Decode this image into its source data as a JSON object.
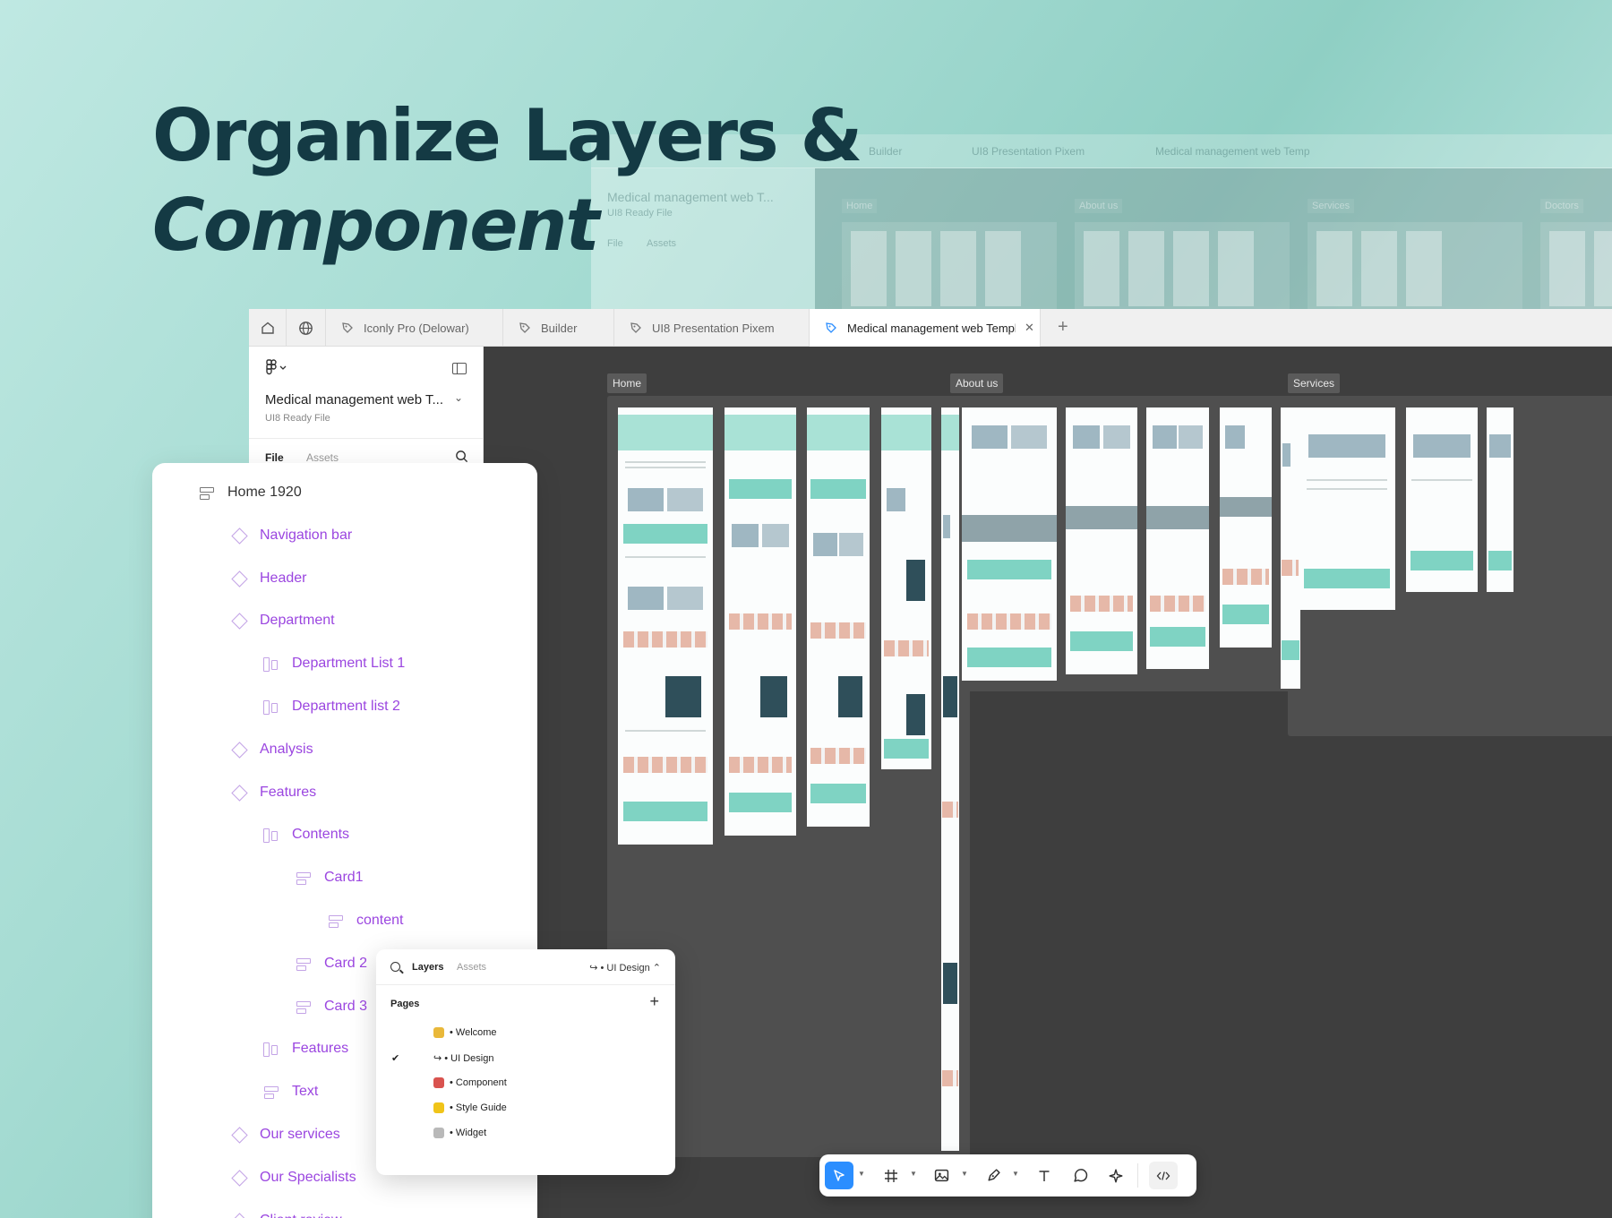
{
  "headline": {
    "line1": "Organize Layers &",
    "line2": "Component"
  },
  "ghost": {
    "tabs": [
      "Builder",
      "UI8 Presentation Pixem",
      "Medical management web Temp"
    ],
    "file_title": "Medical management web T...",
    "file_sub": "UI8 Ready File",
    "side_file": "File",
    "side_assets": "Assets",
    "boards": [
      "Home",
      "About us",
      "Services",
      "Doctors"
    ]
  },
  "tabs": [
    {
      "label": "Iconly Pro (Delowar)"
    },
    {
      "label": "Builder"
    },
    {
      "label": "UI8 Presentation Pixem"
    },
    {
      "label": "Medical management web Templ"
    }
  ],
  "tab_plus": "+",
  "tab_close": "✕",
  "sidebar": {
    "file_title": "Medical management web T...",
    "file_sub": "UI8 Ready File",
    "tab_file": "File",
    "tab_assets": "Assets"
  },
  "canvas": {
    "boards": [
      "Home",
      "About us",
      "Services"
    ]
  },
  "layers": [
    {
      "label": "Home 1920",
      "icon": "stack",
      "level": 0
    },
    {
      "label": "Navigation bar",
      "icon": "diamond",
      "level": 1
    },
    {
      "label": "Header",
      "icon": "diamond",
      "level": 1
    },
    {
      "label": "Department",
      "icon": "diamond",
      "level": 1
    },
    {
      "label": "Department List 1",
      "icon": "frame",
      "level": 2
    },
    {
      "label": "Department list 2",
      "icon": "frame",
      "level": 2
    },
    {
      "label": "Analysis",
      "icon": "diamond",
      "level": 1
    },
    {
      "label": "Features",
      "icon": "diamond",
      "level": 1
    },
    {
      "label": "Contents",
      "icon": "frame",
      "level": 2
    },
    {
      "label": "Card1",
      "icon": "stack",
      "level": 3
    },
    {
      "label": "content",
      "icon": "stack",
      "level": 4
    },
    {
      "label": "Card 2",
      "icon": "stack",
      "level": 3
    },
    {
      "label": "Card 3",
      "icon": "stack",
      "level": 3
    },
    {
      "label": "Features",
      "icon": "frame",
      "level": 2
    },
    {
      "label": "Text",
      "icon": "stack",
      "level": 2
    },
    {
      "label": "Our services",
      "icon": "diamond",
      "level": 1
    },
    {
      "label": "Our Specialists",
      "icon": "diamond",
      "level": 1
    },
    {
      "label": "Client review",
      "icon": "diamond",
      "level": 1
    }
  ],
  "pages_panel": {
    "tab_layers": "Layers",
    "tab_assets": "Assets",
    "current_page": "↪ • UI Design ⌃",
    "pages_heading": "Pages",
    "add": "+",
    "check": "✔",
    "items": [
      {
        "label": "• Welcome",
        "color": "#e9b83a"
      },
      {
        "label": "↪ • UI Design",
        "color": ""
      },
      {
        "label": "• Component",
        "color": "#d9534f"
      },
      {
        "label": "• Style Guide",
        "color": "#f0c419"
      },
      {
        "label": "• Widget",
        "color": "#b9b9b9"
      }
    ]
  },
  "colors": {
    "accent": "#2b8eff",
    "layer_purple": "#9b46e0",
    "headline": "#143a44",
    "canvas": "#3e3e3e"
  }
}
